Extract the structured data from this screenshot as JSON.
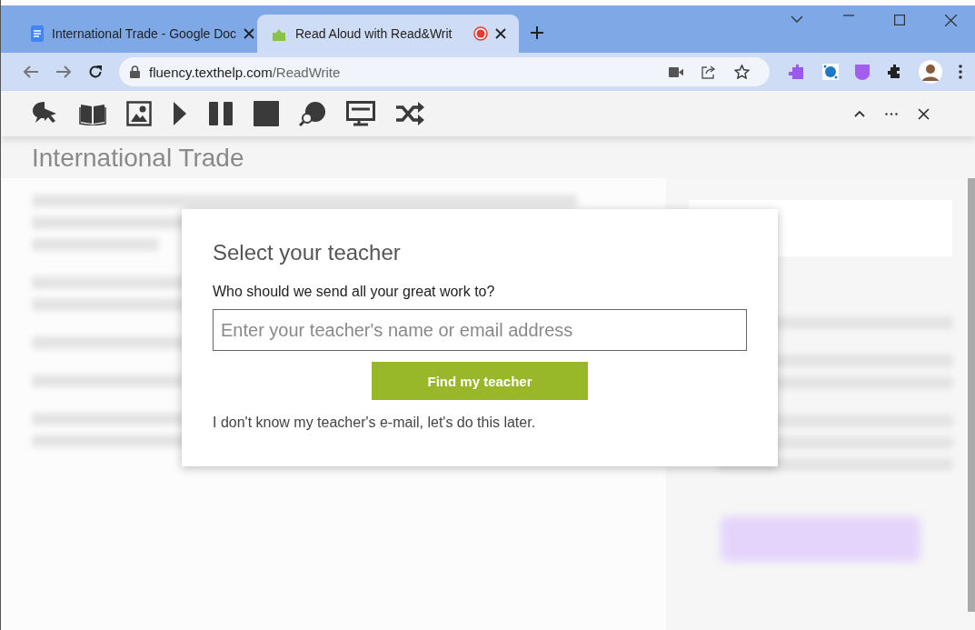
{
  "tabs": [
    {
      "kind": "docs",
      "title": "International Trade - Google Doc",
      "selected": false,
      "recording": false
    },
    {
      "kind": "readwrite",
      "title": "Read Aloud with Read&Writ",
      "selected": true,
      "recording": true
    }
  ],
  "address_bar": {
    "host": "fluency.texthelp.com",
    "path": "/ReadWrite"
  },
  "toolbar": {
    "tools": [
      {
        "kind": "speech"
      },
      {
        "kind": "book"
      },
      {
        "kind": "picture"
      },
      {
        "kind": "play"
      },
      {
        "kind": "pause"
      },
      {
        "kind": "stop"
      },
      {
        "kind": "globe-search"
      },
      {
        "kind": "screen"
      },
      {
        "kind": "shuffle"
      }
    ]
  },
  "document": {
    "title": "International Trade"
  },
  "dialog": {
    "title": "Select your teacher",
    "question": "Who should we send all your great work to?",
    "placeholder": "Enter your teacher's name or email address",
    "button": "Find my teacher",
    "later_link": "I don't know my teacher's e-mail, let's do this later."
  }
}
